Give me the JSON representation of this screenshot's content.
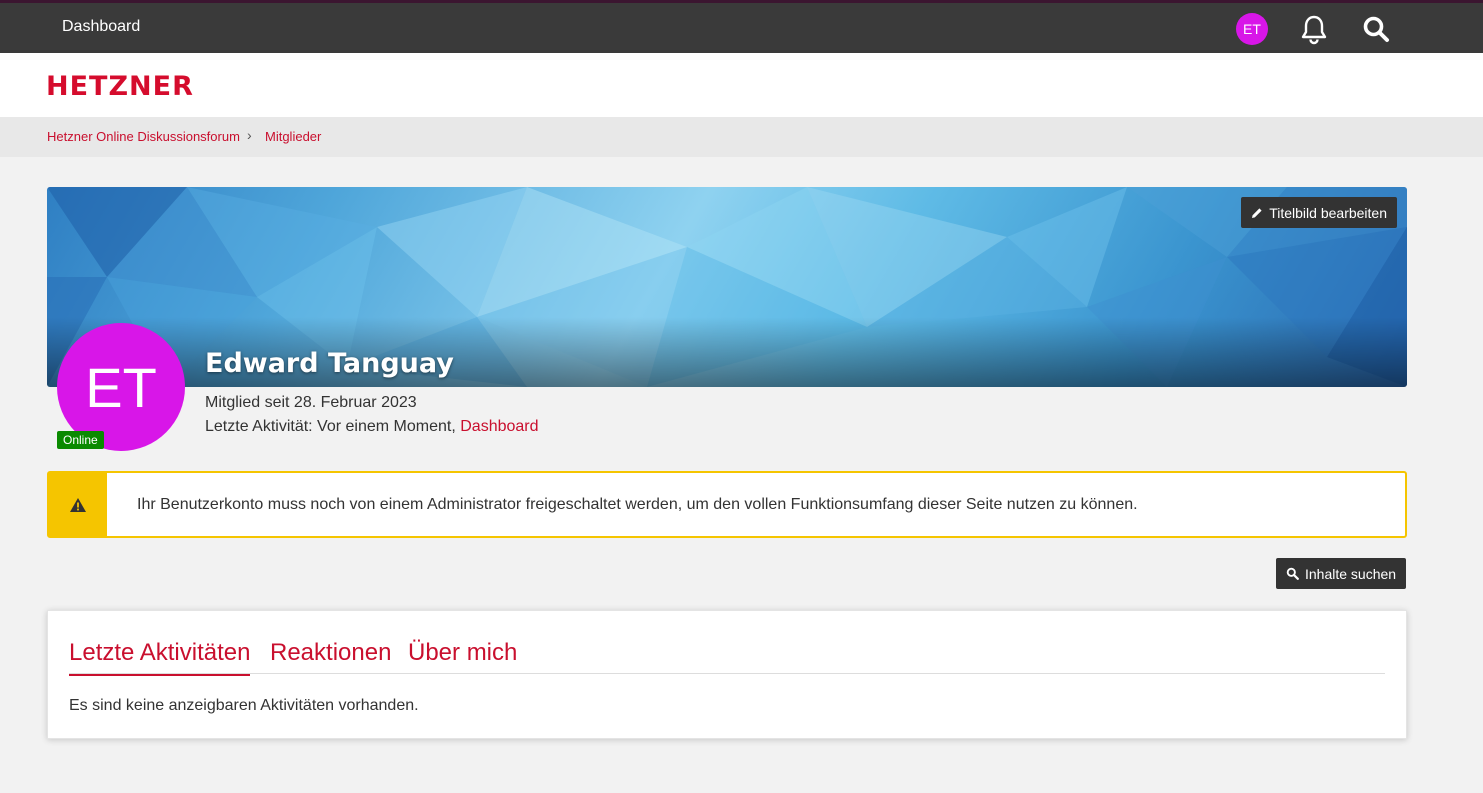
{
  "topbar": {
    "dashboard_label": "Dashboard",
    "avatar_initials": "ET",
    "avatar_color": "#d816e8"
  },
  "brand": {
    "logo_text": "HETZNER",
    "logo_color": "#d50c2d"
  },
  "breadcrumb": {
    "items": [
      "Hetzner Online Diskussionsforum",
      "Mitglieder"
    ],
    "separator": "›"
  },
  "profile": {
    "cover_button_label": "Titelbild bearbeiten",
    "name": "Edward Tanguay",
    "avatar_initials": "ET",
    "status_badge": "Online",
    "member_since": "Mitglied seit 28. Februar 2023",
    "last_activity_prefix": "Letzte Aktivität: Vor einem Moment, ",
    "last_activity_link": "Dashboard"
  },
  "alert": {
    "icon": "warning-icon",
    "message": "Ihr Benutzerkonto muss noch von einem Administrator freigeschaltet werden, um den vollen Funktionsumfang dieser Seite nutzen zu können."
  },
  "actions": {
    "search_content_label": "Inhalte suchen"
  },
  "tabs": [
    {
      "label": "Letzte Aktivitäten",
      "active": true
    },
    {
      "label": "Reaktionen",
      "active": false
    },
    {
      "label": "Über mich",
      "active": false
    }
  ],
  "activity": {
    "empty_message": "Es sind keine anzeigbaren Aktivitäten vorhanden."
  },
  "colors": {
    "accent": "#c90f2e",
    "warning": "#f5c500",
    "online": "#0a8a00",
    "topbar": "#3a3a3a"
  }
}
